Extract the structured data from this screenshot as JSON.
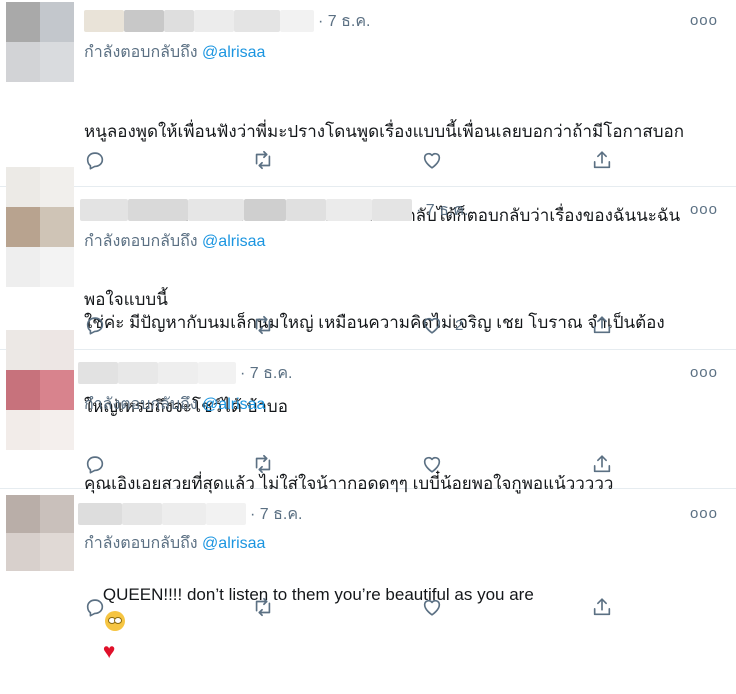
{
  "tweets": [
    {
      "date": "· 7 ธ.ค.",
      "replying_prefix": "กำลังตอบกลับถึง",
      "replying_handle": "@alrisaa",
      "lines": [
        "หนูลองพูดให้เพื่อนฟังว่าพี่มะปรางโดนพูดเรื่องแบบนี้เพื่อนเลยบอกว่าถ้ามีโอกาสบอก",
        "พี่มะปรางก็บอกพี่ไปว่าไม่ต้องไปสนใจถ้าตอบกลับได้ก็ตอบกลับว่าเรื่องของฉันนะฉัน",
        "พอใจแบบนี้"
      ],
      "like_count": "",
      "avatar_colors": [
        "#a9a9a9",
        "#c3c7cc",
        "#d2d3d6",
        "#d9dbde"
      ],
      "name_blur_colors": [
        "#e9e3d8",
        "#c8c8c8",
        "#dedede",
        "#ececec",
        "#e4e4e4",
        "#f2f2f2"
      ]
    },
    {
      "date": "· 7 ธ.ค.",
      "replying_prefix": "กำลังตอบกลับถึง",
      "replying_handle": "@alrisaa",
      "lines": [
        "ใช่ค่ะ มีปัญหากับนมเล็กนมใหญ่ เหมือนความคิดไม่เจริญ เชย โบราณ จำเป็นต้อง",
        "ใหญ่เหรอถึงจะโชว์ได้ บ้าบอ"
      ],
      "like_count": "2",
      "avatar_colors": [
        "#eceae6",
        "#f1efec",
        "#b8a38f",
        "#cfc4b6",
        "#eeeeee",
        "#f3f3f3"
      ],
      "name_blur_colors": [
        "#e3e3e3",
        "#d9d9d9",
        "#e6e6e6",
        "#cfcfcf",
        "#e0e0e0",
        "#ebebeb",
        "#e4e4e4"
      ]
    },
    {
      "date": "· 7 ธ.ค.",
      "replying_prefix": "กำลังตอบกลับถึง",
      "replying_handle": "@alrisaa",
      "lines": [
        "คุณเอิงเอยสวยที่สุดแล้ว ไม่ใส่ใจน้าากอดดๆๆ เบบี๋น้อยพอใจกูพอแน้ววววว"
      ],
      "like_count": "",
      "avatar_colors": [
        "#ece8e5",
        "#ede6e4",
        "#c7727c",
        "#d8838d",
        "#f2ece9",
        "#f4efed"
      ],
      "name_blur_colors": [
        "#e2e2e2",
        "#e8e8e8",
        "#eeeeee",
        "#f2f2f2"
      ]
    },
    {
      "date": "· 7 ธ.ค.",
      "replying_prefix": "กำลังตอบกลับถึง",
      "replying_handle": "@alrisaa",
      "text": "QUEEN!!!! don’t listen to them you’re beautiful as you are",
      "like_count": "",
      "avatar_colors": [
        "#b9aea8",
        "#c9c0bb",
        "#d8d0cc",
        "#e0d9d5"
      ],
      "name_blur_colors": [
        "#dddddd",
        "#e6e6e6",
        "#ededed",
        "#f2f2f2"
      ]
    }
  ],
  "icons": {
    "reply": "reply-icon",
    "retweet": "retweet-icon",
    "like": "heart-icon",
    "share": "share-icon",
    "more": "more-icon"
  },
  "more_glyph": "ooo",
  "heart_glyph": "♥"
}
